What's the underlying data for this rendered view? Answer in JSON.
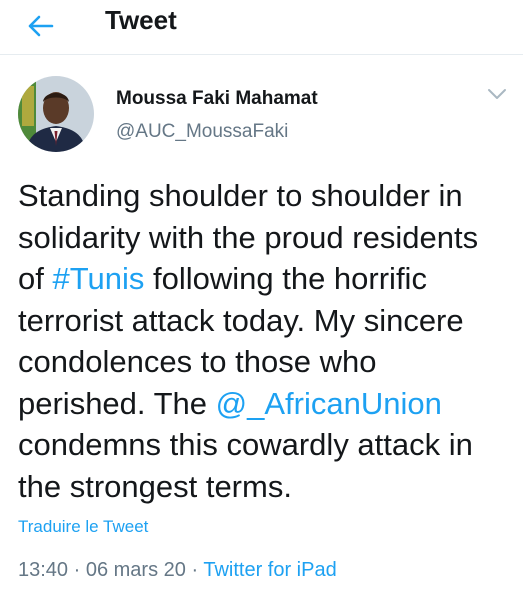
{
  "header": {
    "title": "Tweet",
    "back_icon": "arrow-left-icon"
  },
  "author": {
    "name": "Moussa Faki Mahamat",
    "handle": "@AUC_MoussaFaki"
  },
  "tweet": {
    "lines": {
      "l1": "Standing shoulder to shoulder in",
      "l2": "solidarity with the proud residents",
      "l3_pre": "of ",
      "l3_link": "#Tunis",
      "l3_post": " following the horrific",
      "l4": "terrorist attack today. My sincere",
      "l5": "condolences to those who",
      "l6_pre": "perished. The ",
      "l6_link": "@_AfricanUnion",
      "l7": "condemns this cowardly attack in",
      "l8": "the strongest terms."
    }
  },
  "translate_label": "Traduire le Tweet",
  "meta": {
    "time": "13:40",
    "sep1": " · ",
    "date": "06 mars 20",
    "sep2": " · ",
    "source": "Twitter for iPad"
  },
  "colors": {
    "link": "#1da1f2",
    "secondary": "#657786",
    "text": "#14171a"
  }
}
